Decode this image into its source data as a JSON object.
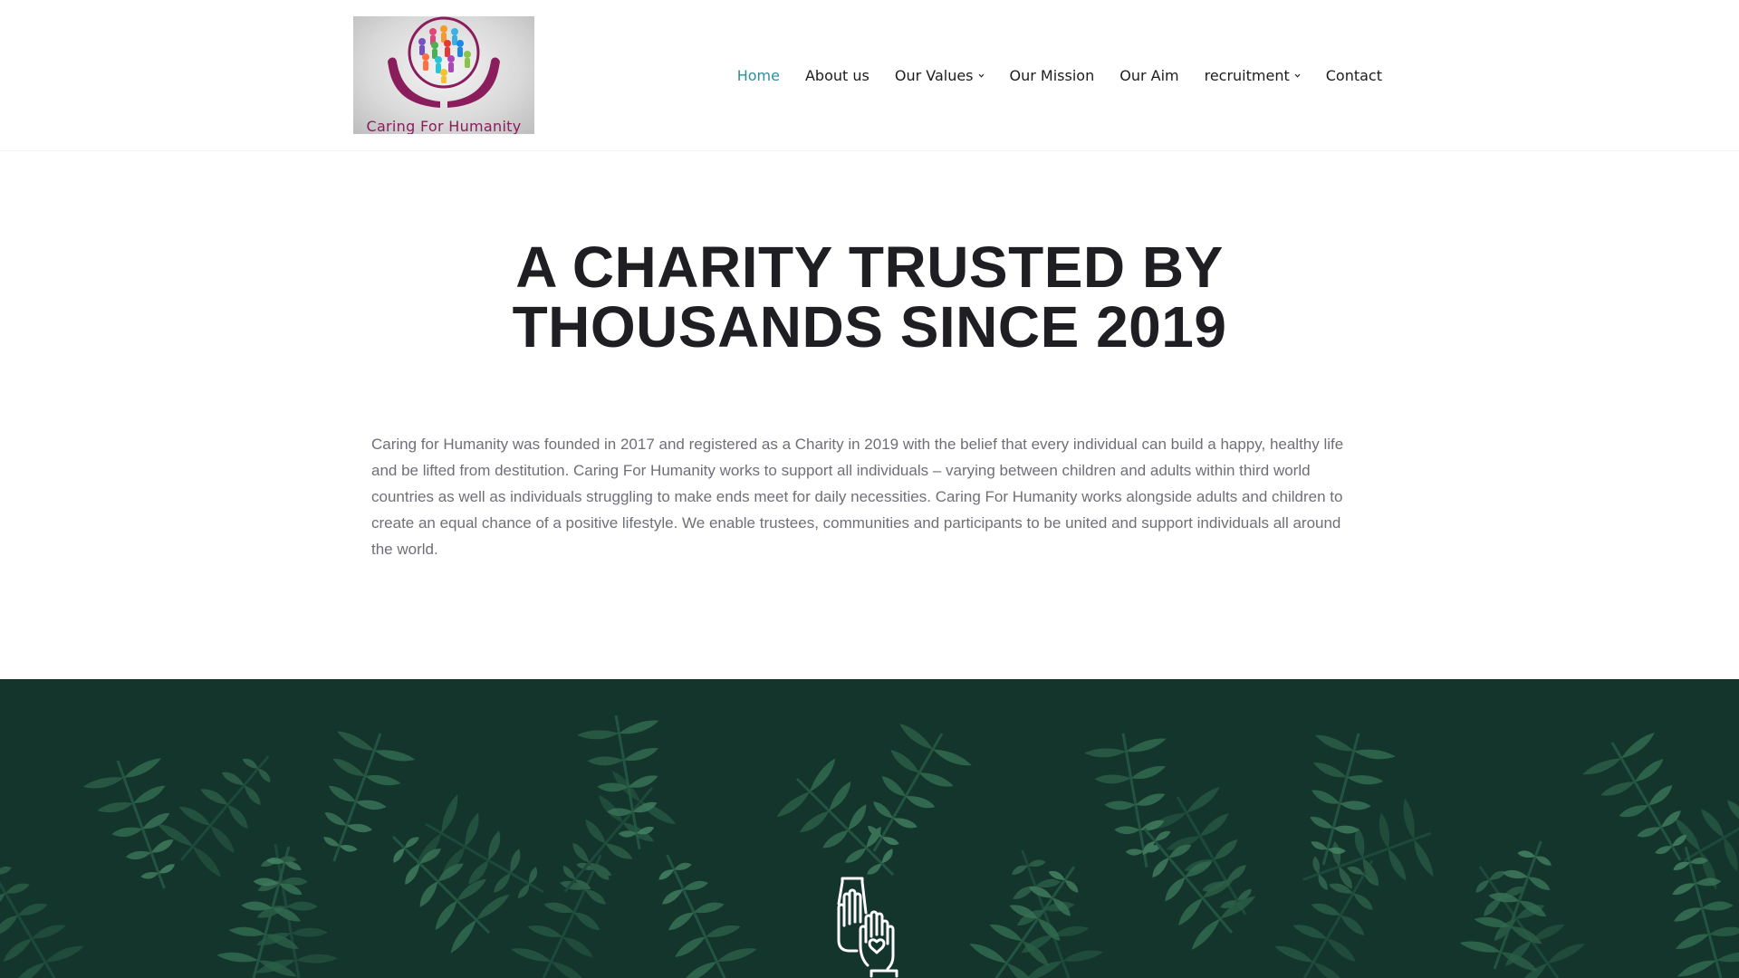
{
  "header": {
    "logo": {
      "text": "Caring For Humanity",
      "colors": {
        "hands": "#8a1d5c",
        "ring": "#8a1d5c"
      }
    },
    "nav": [
      {
        "label": "Home",
        "active": true,
        "dropdown": false
      },
      {
        "label": "About us",
        "active": false,
        "dropdown": false
      },
      {
        "label": "Our Values",
        "active": false,
        "dropdown": true
      },
      {
        "label": "Our Mission",
        "active": false,
        "dropdown": false
      },
      {
        "label": "Our Aim",
        "active": false,
        "dropdown": false
      },
      {
        "label": "recruitment",
        "active": false,
        "dropdown": true
      },
      {
        "label": "Contact",
        "active": false,
        "dropdown": false
      }
    ]
  },
  "hero": {
    "headline_line1": "A CHARITY TRUSTED BY",
    "headline_line2": "THOUSANDS SINCE 2019",
    "intro": "Caring for Humanity was founded in 2017 and registered as a Charity in 2019 with the belief that every individual can build a happy, healthy life and be lifted from destitution. Caring For Humanity works to support all individuals – varying between children and adults within third world countries as well as individuals struggling to make ends meet for daily necessities. Caring For Humanity works alongside adults and children to create an equal chance of a positive lifestyle. We enable trustees, communities and participants to be united and support individuals all around the world."
  },
  "banner": {
    "background": "#15382f",
    "icon": "holding-hands-heart-icon"
  },
  "colors": {
    "accent": "#2f8f9d",
    "text": "#1c1c1e",
    "body_text": "#6f6f78"
  }
}
